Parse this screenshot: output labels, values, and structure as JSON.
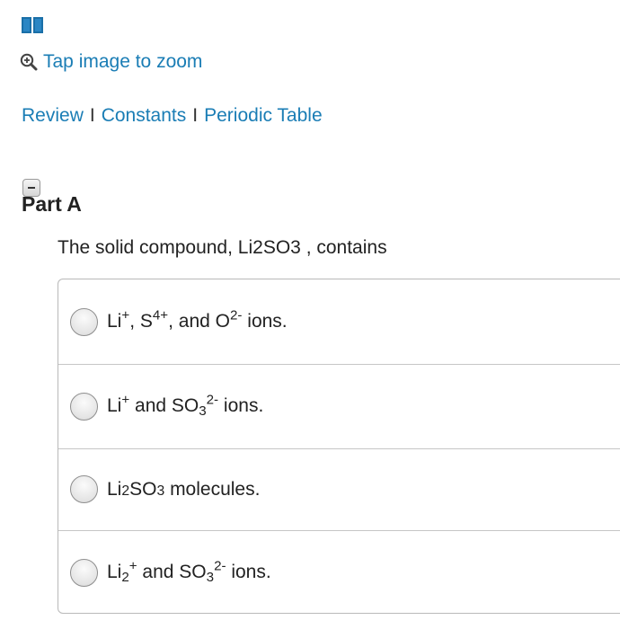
{
  "header": {
    "book_icon": "book-icon",
    "zoom_icon": "zoom-in-icon",
    "zoom_label": "Tap image to zoom",
    "accent_color": "#1a7db5"
  },
  "nav_links": {
    "review": "Review",
    "separator": "I",
    "constants": "Constants",
    "periodic_table": "Periodic Table"
  },
  "part": {
    "collapse_icon": "collapse-icon",
    "title": "Part A"
  },
  "question": {
    "prefix": "The solid compound, Li",
    "sub1": "2",
    "mid": "SO",
    "sub2": "3",
    "suffix": " , contains"
  },
  "options": [
    {
      "a": "Li",
      "a_sup": "+",
      "b": ", S",
      "b_sup": "4+",
      "c": ", and O",
      "c_sup": "2-",
      "d": " ions."
    },
    {
      "a": "Li",
      "a_sup": "+",
      "b": " and SO",
      "b_sub": "3",
      "b_sup": "2-",
      "c": " ions."
    },
    {
      "a": "Li",
      "a_sub": "2",
      "b": "SO",
      "b_sub": "3",
      "c": " molecules."
    },
    {
      "a": "Li",
      "a_sub": "2",
      "a_sup": "+",
      "b": " and SO",
      "b_sub": "3",
      "b_sup": "2-",
      "c": " ions."
    }
  ]
}
